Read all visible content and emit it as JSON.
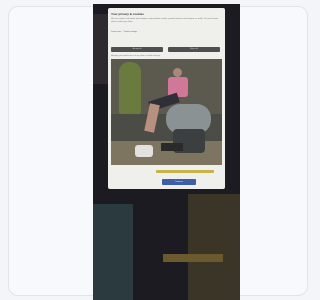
{
  "modal": {
    "title": "Your privacy & cookies",
    "body_text": "We use cookies and similar technologies to personalise content, provide features and analyse our traffic. You can choose which cookies you allow.",
    "link_primary": "Learn more",
    "link_secondary": "Cookie settings",
    "accept_button": "Accept all",
    "reject_button": "Reject all",
    "note": "Manage your preferences at any time in cookie settings.",
    "cta_button": "Continue"
  },
  "photo": {
    "subject": "woman-seated-exercise-chair-icon"
  },
  "colors": {
    "card_background": "#f7f9fc",
    "overlay": "#1c1b22",
    "cta": "#3d5fa8",
    "highlight": "#c8b34a"
  }
}
